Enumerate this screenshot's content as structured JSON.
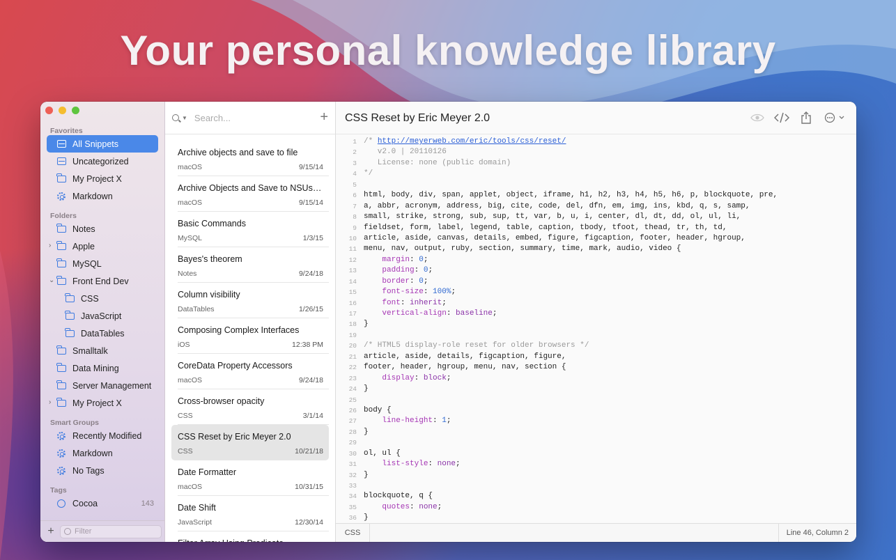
{
  "headline": "Your personal knowledge library",
  "colors": {
    "accent": "#4a88e8",
    "close": "#ee5f56",
    "minimize": "#f5bd2f",
    "zoom": "#5fc53f",
    "comment": "#9a9a9a",
    "property": "#a535b4",
    "value": "#8a32a8",
    "number": "#3069d1",
    "link": "#2a5ed6"
  },
  "sidebar": {
    "favorites_label": "Favorites",
    "favorites": [
      {
        "label": "All Snippets",
        "icon": "tray-icon",
        "selected": true
      },
      {
        "label": "Uncategorized",
        "icon": "tray-icon"
      },
      {
        "label": "My Project X",
        "icon": "folder-icon"
      },
      {
        "label": "Markdown",
        "icon": "gear-icon"
      }
    ],
    "folders_label": "Folders",
    "folders": [
      {
        "label": "Notes"
      },
      {
        "label": "Apple",
        "chevron": "›"
      },
      {
        "label": "MySQL"
      },
      {
        "label": "Front End Dev",
        "chevron": "⌄"
      },
      {
        "label": "CSS",
        "sub": true
      },
      {
        "label": "JavaScript",
        "sub": true
      },
      {
        "label": "DataTables",
        "sub": true
      },
      {
        "label": "Smalltalk"
      },
      {
        "label": "Data Mining"
      },
      {
        "label": "Server Management"
      },
      {
        "label": "My Project X",
        "chevron": "›"
      }
    ],
    "smart_label": "Smart Groups",
    "smart": [
      {
        "label": "Recently Modified"
      },
      {
        "label": "Markdown"
      },
      {
        "label": "No Tags"
      }
    ],
    "tags_label": "Tags",
    "tags": [
      {
        "label": "Cocoa",
        "count": "143"
      }
    ],
    "filter_placeholder": "Filter",
    "add_label": "+"
  },
  "list": {
    "search_placeholder": "Search...",
    "add_label": "+",
    "rows": [
      {
        "title": "Archive objects and save to file",
        "group": "macOS",
        "date": "9/15/14"
      },
      {
        "title": "Archive Objects and Save to NSUser...",
        "group": "macOS",
        "date": "9/15/14"
      },
      {
        "title": "Basic Commands",
        "group": "MySQL",
        "date": "1/3/15"
      },
      {
        "title": "Bayes's theorem",
        "group": "Notes",
        "date": "9/24/18"
      },
      {
        "title": "Column visibility",
        "group": "DataTables",
        "date": "1/26/15"
      },
      {
        "title": "Composing Complex Interfaces",
        "group": "iOS",
        "date": "12:38 PM"
      },
      {
        "title": "CoreData Property Accessors",
        "group": "macOS",
        "date": "9/24/18"
      },
      {
        "title": "Cross-browser opacity",
        "group": "CSS",
        "date": "3/1/14"
      },
      {
        "title": "CSS Reset by Eric Meyer 2.0",
        "group": "CSS",
        "date": "10/21/18",
        "selected": true
      },
      {
        "title": "Date Formatter",
        "group": "macOS",
        "date": "10/31/15"
      },
      {
        "title": "Date Shift",
        "group": "JavaScript",
        "date": "12/30/14"
      },
      {
        "title": "Filter Array Using Predicate",
        "group": "",
        "date": ""
      }
    ]
  },
  "editor": {
    "title": "CSS Reset by Eric Meyer 2.0",
    "toolbar": {
      "preview_icon": "eye-icon",
      "code_icon": "code-icon",
      "share_icon": "share-icon",
      "more_icon": "ellipsis-icon"
    },
    "language": "CSS",
    "cursor": "Line 46, Column 2",
    "lines": [
      [
        [
          "c",
          "/* "
        ],
        [
          "l",
          "http://meyerweb.com/eric/tools/css/reset/"
        ]
      ],
      [
        [
          "c",
          "   v2.0 | 20110126"
        ]
      ],
      [
        [
          "c",
          "   License: none (public domain)"
        ]
      ],
      [
        [
          "c",
          "*/"
        ]
      ],
      [],
      [
        [
          "t",
          "html, body, div, span, applet, object, iframe, h1, h2, h3, h4, h5, h6, p, blockquote, pre,"
        ]
      ],
      [
        [
          "t",
          "a, abbr, acronym, address, big, cite, code, del, dfn, em, img, ins, kbd, q, s, samp,"
        ]
      ],
      [
        [
          "t",
          "small, strike, strong, sub, sup, tt, var, b, u, i, center, dl, dt, dd, ol, ul, li,"
        ]
      ],
      [
        [
          "t",
          "fieldset, form, label, legend, table, caption, tbody, tfoot, thead, tr, th, td,"
        ]
      ],
      [
        [
          "t",
          "article, aside, canvas, details, embed, figure, figcaption, footer, header, hgroup,"
        ]
      ],
      [
        [
          "t",
          "menu, nav, output, ruby, section, summary, time, mark, audio, video {"
        ]
      ],
      [
        [
          "t",
          "    "
        ],
        [
          "p",
          "margin"
        ],
        [
          "t",
          ": "
        ],
        [
          "n",
          "0"
        ],
        [
          "t",
          ";"
        ]
      ],
      [
        [
          "t",
          "    "
        ],
        [
          "p",
          "padding"
        ],
        [
          "t",
          ": "
        ],
        [
          "n",
          "0"
        ],
        [
          "t",
          ";"
        ]
      ],
      [
        [
          "t",
          "    "
        ],
        [
          "p",
          "border"
        ],
        [
          "t",
          ": "
        ],
        [
          "n",
          "0"
        ],
        [
          "t",
          ";"
        ]
      ],
      [
        [
          "t",
          "    "
        ],
        [
          "p",
          "font-size"
        ],
        [
          "t",
          ": "
        ],
        [
          "n",
          "100%"
        ],
        [
          "t",
          ";"
        ]
      ],
      [
        [
          "t",
          "    "
        ],
        [
          "p",
          "font"
        ],
        [
          "t",
          ": "
        ],
        [
          "v",
          "inherit"
        ],
        [
          "t",
          ";"
        ]
      ],
      [
        [
          "t",
          "    "
        ],
        [
          "p",
          "vertical-align"
        ],
        [
          "t",
          ": "
        ],
        [
          "v",
          "baseline"
        ],
        [
          "t",
          ";"
        ]
      ],
      [
        [
          "t",
          "}"
        ]
      ],
      [],
      [
        [
          "c",
          "/* HTML5 display-role reset for older browsers */"
        ]
      ],
      [
        [
          "t",
          "article, aside, details, figcaption, figure,"
        ]
      ],
      [
        [
          "t",
          "footer, header, hgroup, menu, nav, section {"
        ]
      ],
      [
        [
          "t",
          "    "
        ],
        [
          "p",
          "display"
        ],
        [
          "t",
          ": "
        ],
        [
          "v",
          "block"
        ],
        [
          "t",
          ";"
        ]
      ],
      [
        [
          "t",
          "}"
        ]
      ],
      [],
      [
        [
          "t",
          "body {"
        ]
      ],
      [
        [
          "t",
          "    "
        ],
        [
          "p",
          "line-height"
        ],
        [
          "t",
          ": "
        ],
        [
          "n",
          "1"
        ],
        [
          "t",
          ";"
        ]
      ],
      [
        [
          "t",
          "}"
        ]
      ],
      [],
      [
        [
          "t",
          "ol, ul {"
        ]
      ],
      [
        [
          "t",
          "    "
        ],
        [
          "p",
          "list-style"
        ],
        [
          "t",
          ": "
        ],
        [
          "v",
          "none"
        ],
        [
          "t",
          ";"
        ]
      ],
      [
        [
          "t",
          "}"
        ]
      ],
      [],
      [
        [
          "t",
          "blockquote, q {"
        ]
      ],
      [
        [
          "t",
          "    "
        ],
        [
          "p",
          "quotes"
        ],
        [
          "t",
          ": "
        ],
        [
          "v",
          "none"
        ],
        [
          "t",
          ";"
        ]
      ],
      [
        [
          "t",
          "}"
        ]
      ],
      []
    ]
  }
}
